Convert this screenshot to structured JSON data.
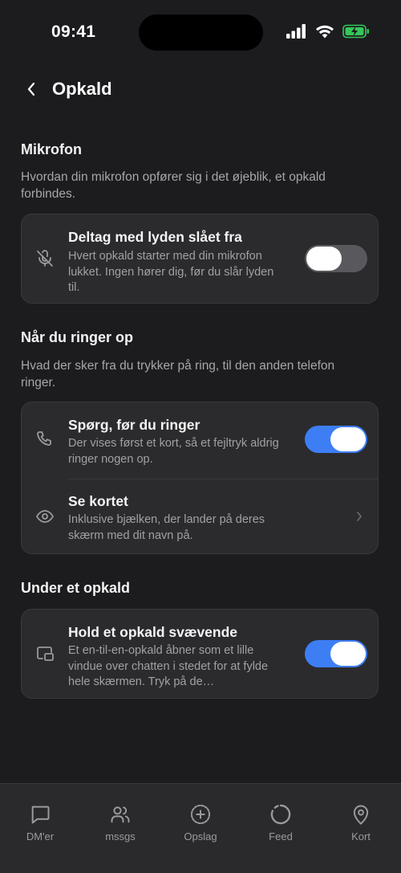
{
  "status_bar": {
    "time": "09:41"
  },
  "header": {
    "title": "Opkald"
  },
  "sections": {
    "microphone": {
      "title": "Mikrofon",
      "description": "Hvordan din mikrofon opfører sig i det øjeblik, et opkald forbindes.",
      "rows": [
        {
          "icon": "mic-off-icon",
          "title": "Deltag med lyden slået fra",
          "subtitle": "Hvert opkald starter med din mikrofon lukket. Ingen hører dig, før du slår lyden til.",
          "toggle": "off"
        }
      ]
    },
    "calling": {
      "title": "Når du ringer op",
      "description": "Hvad der sker fra du trykker på ring, til den anden telefon ringer.",
      "rows": [
        {
          "icon": "phone-icon",
          "title": "Spørg, før du ringer",
          "subtitle": "Der vises først et kort, så et fejltryk aldrig ringer nogen op.",
          "toggle": "on"
        },
        {
          "icon": "eye-icon",
          "title": "Se kortet",
          "subtitle": "Inklusive bjælken, der lander på deres skærm med dit navn på.",
          "chevron": "chevron-right-icon"
        }
      ]
    },
    "during_call": {
      "title": "Under et opkald",
      "rows": [
        {
          "icon": "picture-in-picture-icon",
          "title": "Hold et opkald svævende",
          "subtitle": "Et en-til-en-opkald åbner som et lille vindue over chatten i stedet for at fylde hele skærmen. Tryk på de…",
          "toggle": "on"
        }
      ]
    }
  },
  "bottom_nav": {
    "items": [
      {
        "label": "DM'er",
        "icon": "message-square-icon"
      },
      {
        "label": "mssgs",
        "icon": "users-icon"
      },
      {
        "label": "Opslag",
        "icon": "plus-circle-icon"
      },
      {
        "label": "Feed",
        "icon": "circle-loader-icon"
      },
      {
        "label": "Kort",
        "icon": "map-pin-icon"
      }
    ]
  },
  "colors": {
    "background": "#1c1c1f",
    "card": "#2b2b2e",
    "toggle_on": "#3d7ef5",
    "toggle_off": "#59595d",
    "battery": "#34c759"
  }
}
